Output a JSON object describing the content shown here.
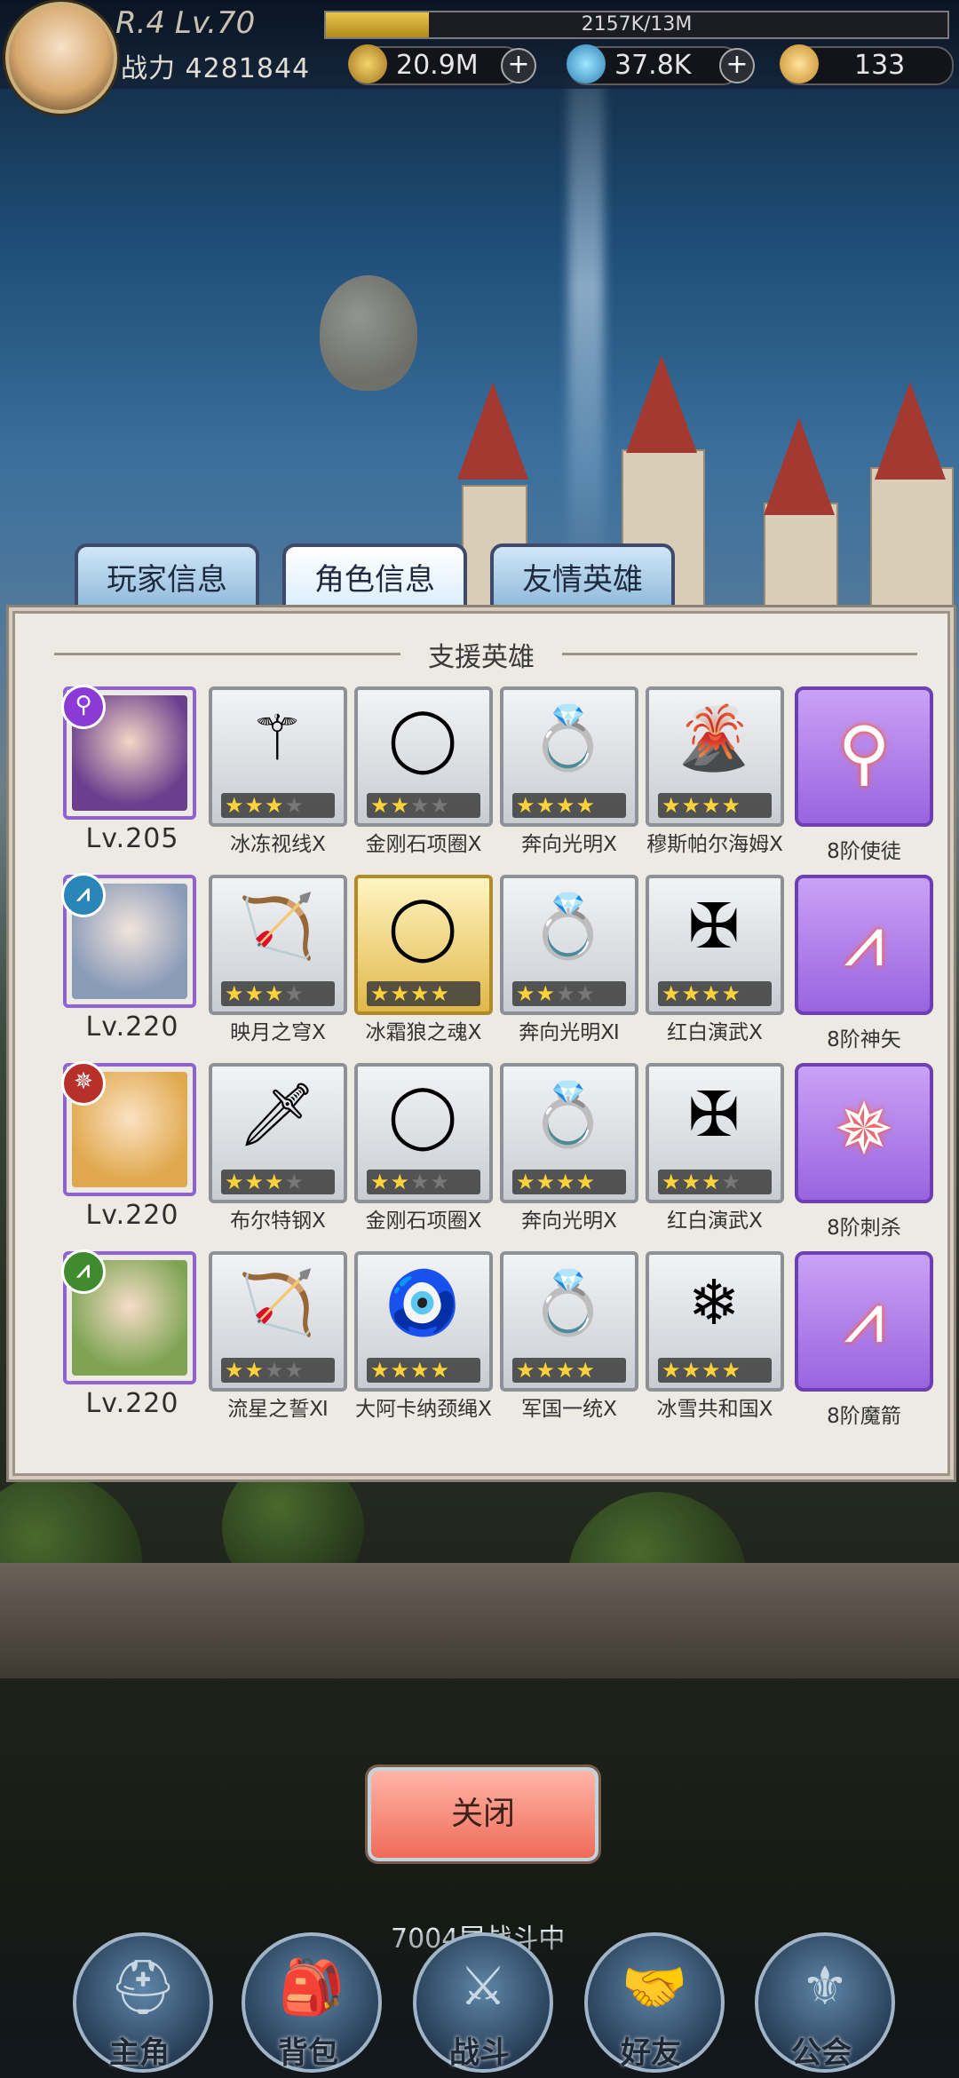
{
  "hud": {
    "rank_level": "R.4 Lv.70",
    "xp_text": "2157K/13M",
    "xp_progress": 0.166,
    "power_label": "战力",
    "power_value": "4281844",
    "gold": "20.9M",
    "gem": "37.8K",
    "ticket": "133"
  },
  "tabs": [
    "玩家信息",
    "角色信息",
    "友情英雄"
  ],
  "panel": {
    "title": "支援英雄"
  },
  "heroes": [
    {
      "level": "Lv.205",
      "class_icon": "magnifier-icon",
      "items": [
        {
          "name": "冰冻视线Ⅹ",
          "stars": 3,
          "icon": "staff-icon"
        },
        {
          "name": "金刚石项圈Ⅹ",
          "stars": 2,
          "icon": "necklace-icon"
        },
        {
          "name": "奔向光明Ⅹ",
          "stars": 4,
          "icon": "ring-icon"
        },
        {
          "name": "穆斯帕尔海姆Ⅹ",
          "stars": 4,
          "icon": "volcano-emblem-icon"
        }
      ],
      "skill": "8阶使徒"
    },
    {
      "level": "Lv.220",
      "class_icon": "bow-class-icon",
      "items": [
        {
          "name": "映月之穹Ⅹ",
          "stars": 3,
          "icon": "bow-icon"
        },
        {
          "name": "冰霜狼之魂Ⅹ",
          "stars": 4,
          "icon": "necklace-icon"
        },
        {
          "name": "奔向光明Ⅺ",
          "stars": 2,
          "icon": "ring-icon"
        },
        {
          "name": "红白演武Ⅹ",
          "stars": 4,
          "icon": "crossed-swords-emblem-icon"
        }
      ],
      "skill": "8阶神矢"
    },
    {
      "level": "Lv.220",
      "class_icon": "shuriken-class-icon",
      "items": [
        {
          "name": "布尔特钢Ⅹ",
          "stars": 3,
          "icon": "sword-icon"
        },
        {
          "name": "金刚石项圈Ⅹ",
          "stars": 2,
          "icon": "necklace-icon"
        },
        {
          "name": "奔向光明Ⅹ",
          "stars": 4,
          "icon": "ring-icon"
        },
        {
          "name": "红白演武Ⅹ",
          "stars": 3,
          "icon": "crossed-swords-emblem-icon"
        }
      ],
      "skill": "8阶刺杀"
    },
    {
      "level": "Lv.220",
      "class_icon": "bow-class-icon",
      "items": [
        {
          "name": "流星之誓Ⅺ",
          "stars": 2,
          "icon": "bow-icon"
        },
        {
          "name": "大阿卡纳颈绳Ⅹ",
          "stars": 4,
          "icon": "pendant-icon"
        },
        {
          "name": "军国一统Ⅹ",
          "stars": 4,
          "icon": "ring-icon"
        },
        {
          "name": "冰雪共和国Ⅹ",
          "stars": 4,
          "icon": "ice-emblem-icon"
        }
      ],
      "skill": "8阶魔箭"
    }
  ],
  "close_button": "关闭",
  "status": "7004层战斗中",
  "nav": [
    "主角",
    "背包",
    "战斗",
    "好友",
    "公会"
  ]
}
